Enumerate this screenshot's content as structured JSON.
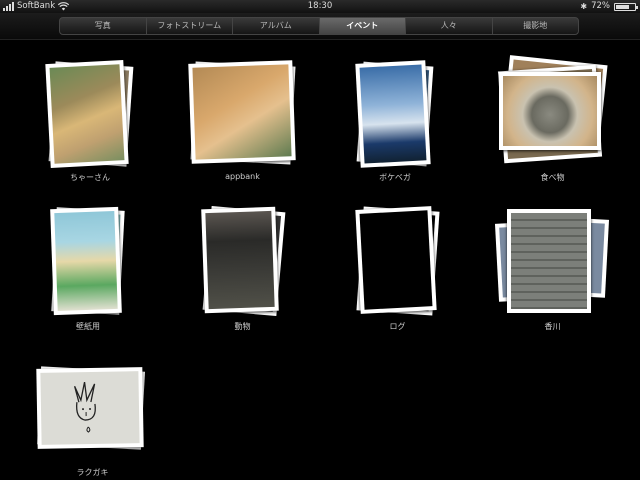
{
  "statusbar": {
    "carrier": "SoftBank",
    "time": "18:30",
    "battery_text": "72%",
    "battery_level": 0.72
  },
  "tabs": [
    {
      "label": "写真",
      "active": false
    },
    {
      "label": "フォトストリーム",
      "active": false
    },
    {
      "label": "アルバム",
      "active": false
    },
    {
      "label": "イベント",
      "active": true
    },
    {
      "label": "人々",
      "active": false
    },
    {
      "label": "撮影地",
      "active": false
    }
  ],
  "albums": [
    {
      "label": "ちゃーさん"
    },
    {
      "label": "appbank"
    },
    {
      "label": "ボケベガ"
    },
    {
      "label": "食べ物"
    },
    {
      "label": "壁紙用"
    },
    {
      "label": "動物"
    },
    {
      "label": "ログ"
    },
    {
      "label": "香川"
    },
    {
      "label": "ラクガキ"
    }
  ]
}
